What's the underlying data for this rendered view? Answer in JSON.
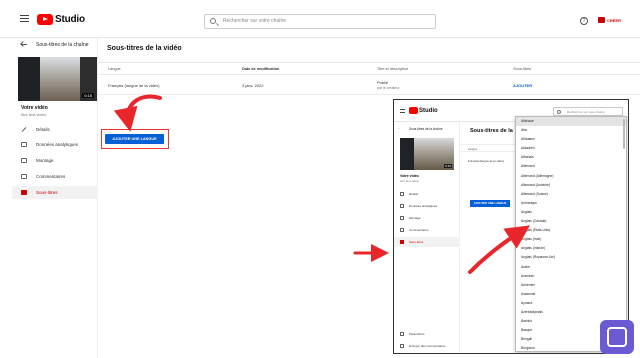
{
  "topbar": {
    "logo_text": "Studio",
    "search_placeholder": "Rechercher sur votre chaîne",
    "help_glyph": "?",
    "create_label": "CRÉER"
  },
  "sidebar": {
    "back_label": "Sous-titres de la chaîne",
    "thumb_duration": "0:15",
    "video_title": "Votre vidéo",
    "video_desc": "titre test vidéo",
    "items": [
      {
        "label": "Détails",
        "icon": "pencil-icon"
      },
      {
        "label": "Données analytiques",
        "icon": "analytics-icon"
      },
      {
        "label": "Montage",
        "icon": "editor-icon"
      },
      {
        "label": "Commentaires",
        "icon": "comments-icon"
      },
      {
        "label": "Sous-titres",
        "icon": "subtitles-icon",
        "active": true
      }
    ]
  },
  "main": {
    "title": "Sous-titres de la vidéo",
    "columns": [
      "Langue",
      "Date de modification",
      "Titre et description",
      "Sous-titres"
    ],
    "row": {
      "language": "Français (langue de la vidéo)",
      "date": "3 janv. 2022",
      "title_status": "Publié",
      "title_author": "par le créateur",
      "subtitle_action": "AJOUTER"
    },
    "add_language_label": "AJOUTER UNE LANGUE"
  },
  "inset": {
    "logo_text": "Studio",
    "search_placeholder": "Rechercher sur votre chaîne",
    "back_label": "Sous-titres de la chaîne",
    "thumb_duration": "0:15",
    "video_title": "Votre vidéo",
    "video_desc": "titre test vidéo",
    "title": "Sous-titres de la",
    "column": "Langue",
    "row_language": "Français (langue de la vidéo)",
    "add_language_label": "AJOUTER UNE LANGUE",
    "nav": [
      "Détails",
      "Données analytiques",
      "Montage",
      "Commentaires",
      "Sous-titres"
    ],
    "footer": [
      "Paramètres",
      "Envoyer des commentaires"
    ],
    "dropdown_items": [
      "Abkhaze",
      "Afar",
      "Afrikaans",
      "Akkadien",
      "Albanais",
      "Allemand",
      "Allemand (Allemagne)",
      "Allemand (Autriche)",
      "Allemand (Suisse)",
      "Amharique",
      "Anglais",
      "Anglais (Canada)",
      "Anglais (États-Unis)",
      "Anglais (Inde)",
      "Anglais (Irlande)",
      "Anglais (Royaume-Uni)",
      "Arabe",
      "Araméen",
      "Arménien",
      "Assamais",
      "Aymara",
      "Azerbaïdjanais",
      "Bachkir",
      "Basque",
      "Bengali",
      "Bhojpouri",
      "Biélorusse"
    ]
  },
  "colors": {
    "brand_red": "#ff0000",
    "accent_blue": "#065fd4",
    "arrow_red": "#e8262b"
  }
}
